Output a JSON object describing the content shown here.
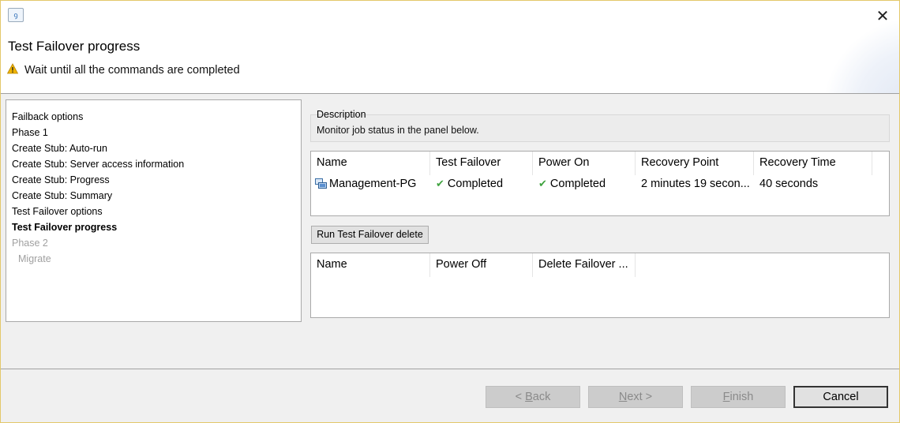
{
  "header": {
    "title": "Test Failover  progress",
    "message": "Wait until all the commands are completed",
    "close_glyph": "✕"
  },
  "nav": {
    "items": [
      {
        "label": "Failback options"
      },
      {
        "label": "Phase 1"
      },
      {
        "label": "Create Stub: Auto-run"
      },
      {
        "label": "Create Stub: Server access information"
      },
      {
        "label": "Create Stub: Progress"
      },
      {
        "label": "Create Stub: Summary"
      },
      {
        "label": "Test Failover  options"
      },
      {
        "label": "Test Failover  progress",
        "state": "active"
      },
      {
        "label": "Phase 2",
        "state": "disabled"
      },
      {
        "label": "Migrate",
        "state": "disabled"
      }
    ]
  },
  "description": {
    "legend": "Description",
    "text": "Monitor job status in the panel below."
  },
  "status_table": {
    "columns": [
      "Name",
      "Test Failover",
      "Power On",
      "Recovery Point",
      "Recovery Time"
    ],
    "rows": [
      {
        "name": "Management-PG",
        "icon": "vm-group-icon",
        "test_failover": "Completed",
        "power_on": "Completed",
        "recovery_point": "2 minutes 19 secon...",
        "recovery_time": "40 seconds"
      }
    ]
  },
  "run_button": {
    "label": "Run Test Failover delete"
  },
  "delete_table": {
    "columns": [
      "Name",
      "Power Off",
      "Delete Failover ..."
    ]
  },
  "footer": {
    "back": {
      "prefix": "< ",
      "mnemonic": "B",
      "rest": "ack"
    },
    "next": {
      "mnemonic": "N",
      "rest": "ext >"
    },
    "finish": {
      "mnemonic": "F",
      "rest": "inish"
    },
    "cancel": {
      "label": "Cancel"
    }
  },
  "colors": {
    "check": "#3fa33f",
    "warning": "#f0b400",
    "window_border": "#e3c86a"
  }
}
